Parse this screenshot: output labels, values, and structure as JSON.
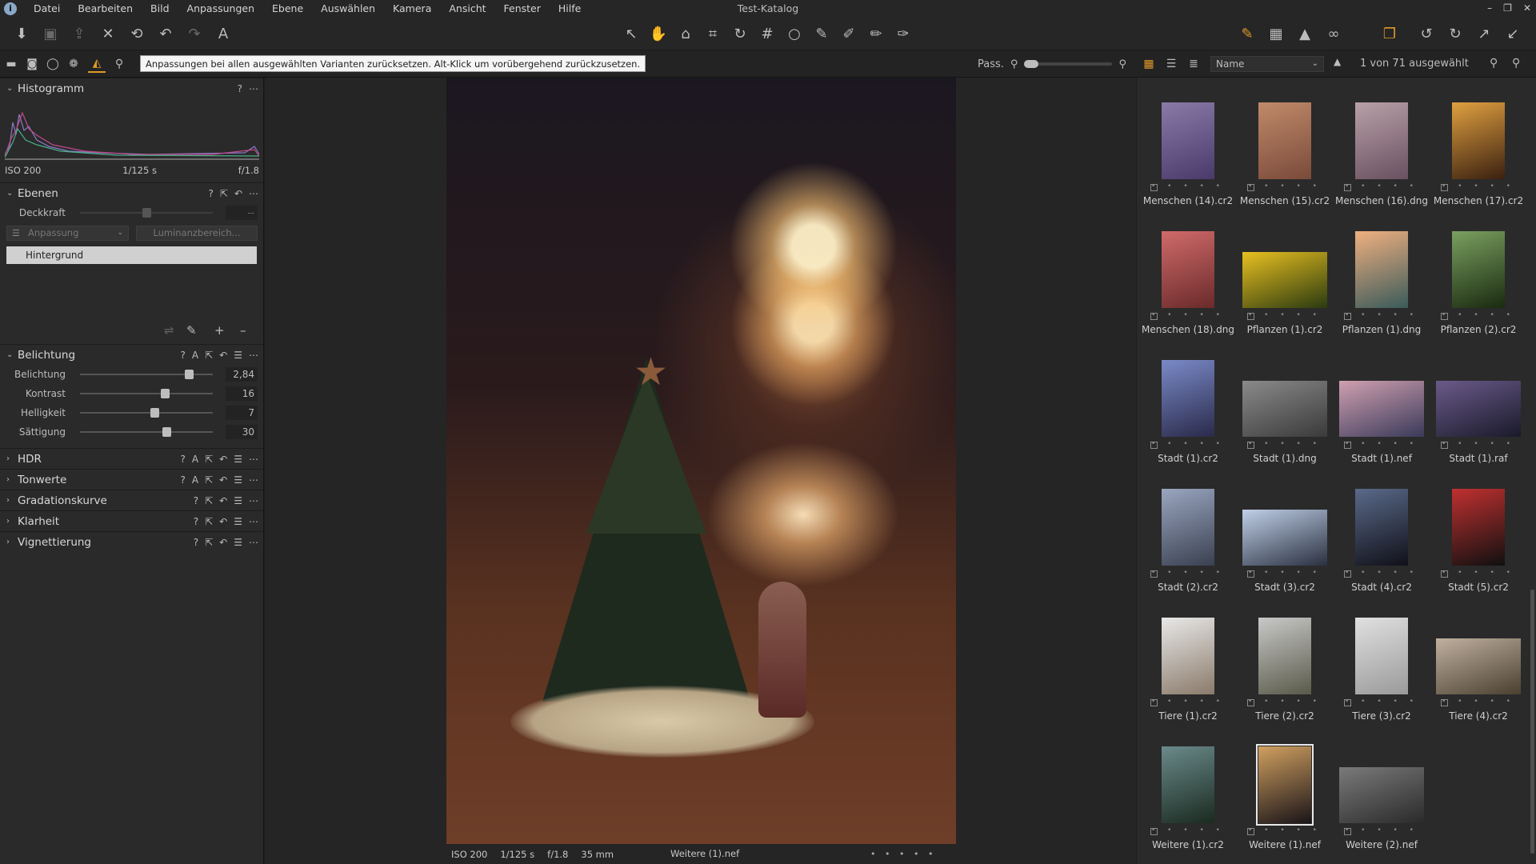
{
  "menubar": {
    "items": [
      "Datei",
      "Bearbeiten",
      "Bild",
      "Anpassungen",
      "Ebene",
      "Auswählen",
      "Kamera",
      "Ansicht",
      "Fenster",
      "Hilfe"
    ],
    "title": "Test-Katalog",
    "window_controls": [
      "–",
      "❐",
      "✕"
    ]
  },
  "toolbar": {
    "left_icons": [
      "import-icon",
      "camera-icon",
      "export-icon",
      "delete-icon",
      "reset-icon",
      "undo-icon",
      "redo-icon",
      "text-icon"
    ],
    "center_icons": [
      "select-cursor-icon",
      "pan-hand-icon",
      "loupe-icon",
      "crop-icon",
      "rotate-icon",
      "keystone-icon",
      "spot-icon",
      "brush-icon",
      "erase-icon",
      "gradient-icon",
      "pick-icon"
    ],
    "right_icons": [
      "edit-mode-icon",
      "grid-icon",
      "warning-icon",
      "proof-glasses-icon",
      "copy-icon",
      "rotate-left-icon",
      "rotate-right-icon",
      "apply-icon",
      "paste-icon"
    ],
    "accent_color": "#e09a2a"
  },
  "tabs": {
    "tooltip": "Anpassungen bei allen ausgewählten Varianten zurücksetzen. Alt-Klick um vorübergehend zurückzusetzen.",
    "pass_label": "Pass.",
    "sort_value": "Name",
    "sort_direction": "▲",
    "selection_count": "1 von 71 ausgewählt"
  },
  "histogram": {
    "title": "Histogramm",
    "iso": "ISO 200",
    "shutter": "1/125 s",
    "aperture": "f/1.8"
  },
  "layers": {
    "title": "Ebenen",
    "opacity_label": "Deckkraft",
    "opacity_value": "--",
    "adjust_dropdown": "Anpassung",
    "luminance_button": "Luminanzbereich...",
    "background_layer": "Hintergrund"
  },
  "exposure": {
    "title": "Belichtung",
    "sliders": [
      {
        "label": "Belichtung",
        "value": "2,84",
        "fraction": 0.82
      },
      {
        "label": "Kontrast",
        "value": "16",
        "fraction": 0.64
      },
      {
        "label": "Helligkeit",
        "value": "7",
        "fraction": 0.56
      },
      {
        "label": "Sättigung",
        "value": "30",
        "fraction": 0.65
      }
    ]
  },
  "collapsed_sections": [
    "HDR",
    "Tonwerte",
    "Gradationskurve",
    "Klarheit",
    "Vignettierung"
  ],
  "viewer": {
    "iso": "ISO 200",
    "shutter": "1/125 s",
    "aperture": "f/1.8",
    "focal": "35 mm",
    "filename": "Weitere (1).nef",
    "stars": "• • • • •"
  },
  "browser": {
    "thumbnails": [
      {
        "name": "Menschen (14).cr2",
        "w": 66,
        "h": 96,
        "c1": "#8a7aa8",
        "c2": "#4a3a6a"
      },
      {
        "name": "Menschen (15).cr2",
        "w": 66,
        "h": 96,
        "c1": "#c08a6a",
        "c2": "#7a4a3a"
      },
      {
        "name": "Menschen (16).dng",
        "w": 66,
        "h": 96,
        "c1": "#b8a0a8",
        "c2": "#6a5060"
      },
      {
        "name": "Menschen (17).cr2",
        "w": 66,
        "h": 96,
        "c1": "#e0a040",
        "c2": "#3a2010"
      },
      {
        "name": "Menschen (18).dng",
        "w": 66,
        "h": 96,
        "c1": "#d06a6a",
        "c2": "#6a2a2a"
      },
      {
        "name": "Pflanzen (1).cr2",
        "w": 106,
        "h": 70,
        "c1": "#e8c020",
        "c2": "#2a3a10"
      },
      {
        "name": "Pflanzen (1).dng",
        "w": 66,
        "h": 96,
        "c1": "#f0b080",
        "c2": "#3a5a5a"
      },
      {
        "name": "Pflanzen (2).cr2",
        "w": 66,
        "h": 96,
        "c1": "#7aa060",
        "c2": "#1a2a10"
      },
      {
        "name": "Stadt (1).cr2",
        "w": 66,
        "h": 96,
        "c1": "#7a8ac8",
        "c2": "#2a2a4a"
      },
      {
        "name": "Stadt (1).dng",
        "w": 106,
        "h": 70,
        "c1": "#8a8a8a",
        "c2": "#3a3a3a"
      },
      {
        "name": "Stadt (1).nef",
        "w": 106,
        "h": 70,
        "c1": "#d0a0b0",
        "c2": "#3a3a5a"
      },
      {
        "name": "Stadt (1).raf",
        "w": 106,
        "h": 70,
        "c1": "#6a5a8a",
        "c2": "#1a1a2a"
      },
      {
        "name": "Stadt (2).cr2",
        "w": 66,
        "h": 96,
        "c1": "#9aa6c0",
        "c2": "#3a4050"
      },
      {
        "name": "Stadt (3).cr2",
        "w": 106,
        "h": 70,
        "c1": "#c0d0e8",
        "c2": "#2a3040"
      },
      {
        "name": "Stadt (4).cr2",
        "w": 66,
        "h": 96,
        "c1": "#5a6a8a",
        "c2": "#101018"
      },
      {
        "name": "Stadt (5).cr2",
        "w": 66,
        "h": 96,
        "c1": "#c03030",
        "c2": "#101010"
      },
      {
        "name": "Tiere (1).cr2",
        "w": 66,
        "h": 96,
        "c1": "#e8e8e8",
        "c2": "#8a7a6a"
      },
      {
        "name": "Tiere (2).cr2",
        "w": 66,
        "h": 96,
        "c1": "#c8c8c8",
        "c2": "#5a5a4a"
      },
      {
        "name": "Tiere (3).cr2",
        "w": 66,
        "h": 96,
        "c1": "#e0e0e0",
        "c2": "#9a9a9a"
      },
      {
        "name": "Tiere (4).cr2",
        "w": 106,
        "h": 70,
        "c1": "#c0b0a0",
        "c2": "#4a4030"
      },
      {
        "name": "Weitere (1).cr2",
        "w": 66,
        "h": 96,
        "c1": "#6a8a8a",
        "c2": "#1a2a20"
      },
      {
        "name": "Weitere (1).nef",
        "w": 66,
        "h": 96,
        "c1": "#d0a060",
        "c2": "#1a1418",
        "selected": true
      },
      {
        "name": "Weitere (2).nef",
        "w": 106,
        "h": 70,
        "c1": "#7a7a7a",
        "c2": "#2a2a2a"
      }
    ]
  }
}
